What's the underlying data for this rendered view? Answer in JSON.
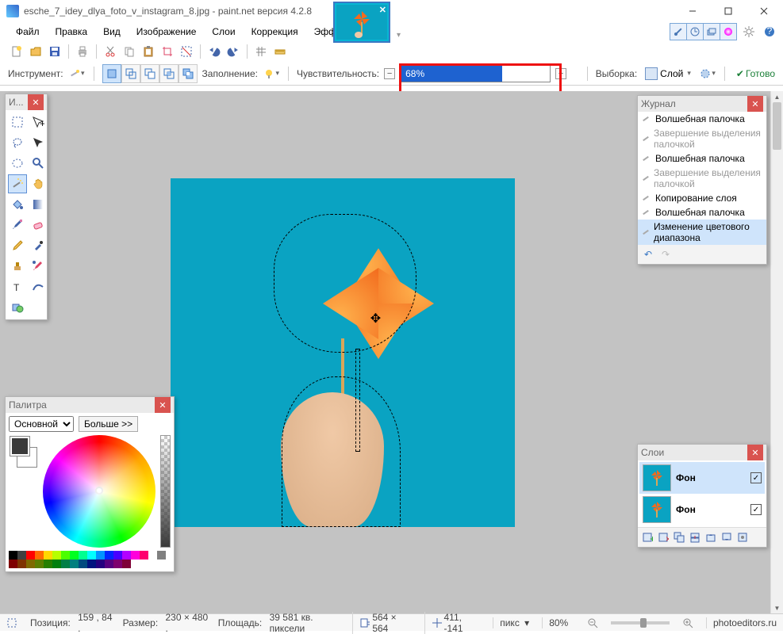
{
  "title": "esche_7_idey_dlya_foto_v_instagram_8.jpg - paint.net версия 4.2.8",
  "menu": [
    "Файл",
    "Правка",
    "Вид",
    "Изображение",
    "Слои",
    "Коррекция",
    "Эффекты"
  ],
  "options": {
    "tool_label": "Инструмент:",
    "fill_label": "Заполнение:",
    "tolerance_label": "Чувствительность:",
    "tolerance_value": "68%",
    "sampling_label": "Выборка:",
    "sampling_value": "Слой",
    "ready": "Готово"
  },
  "tools_panel": {
    "title": "И..."
  },
  "history": {
    "title": "Журнал",
    "items": [
      {
        "label": "Волшебная палочка",
        "dim": false
      },
      {
        "label": "Завершение выделения палочкой",
        "dim": true
      },
      {
        "label": "Волшебная палочка",
        "dim": false
      },
      {
        "label": "Завершение выделения палочкой",
        "dim": true
      },
      {
        "label": "Копирование слоя",
        "dim": false
      },
      {
        "label": "Волшебная палочка",
        "dim": false
      },
      {
        "label": "Изменение цветового диапазона",
        "dim": false,
        "selected": true
      }
    ]
  },
  "layers": {
    "title": "Слои",
    "items": [
      {
        "name": "Фон",
        "visible": true,
        "selected": true
      },
      {
        "name": "Фон",
        "visible": true,
        "selected": false
      }
    ]
  },
  "palette": {
    "title": "Палитра",
    "mode": "Основной",
    "more": "Больше >>",
    "swatches": [
      "#000",
      "#404040",
      "#ff0000",
      "#ff6a00",
      "#ffd800",
      "#b6ff00",
      "#4cff00",
      "#00ff21",
      "#00ff90",
      "#00ffff",
      "#0094ff",
      "#0026ff",
      "#4800ff",
      "#b200ff",
      "#ff00dc",
      "#ff006e",
      "#ffffff",
      "#808080",
      "#7f0000",
      "#7f3300",
      "#7f6a00",
      "#5b7f00",
      "#267f00",
      "#007f0e",
      "#007f46",
      "#007f7f",
      "#004a7f",
      "#00137f",
      "#24007f",
      "#57007f",
      "#7f006e",
      "#7f0037"
    ]
  },
  "status": {
    "pos_label": "Позиция:",
    "pos": "159 , 84 .",
    "size_label": "Размер:",
    "size": "230   × 480 .",
    "area_label": "Площадь:",
    "area": "39 581 кв. пиксели",
    "doc_size": "564  ×  564",
    "cursor": "411, -141",
    "unit": "пикс",
    "zoom": "80%",
    "site": "photoeditors.ru"
  }
}
